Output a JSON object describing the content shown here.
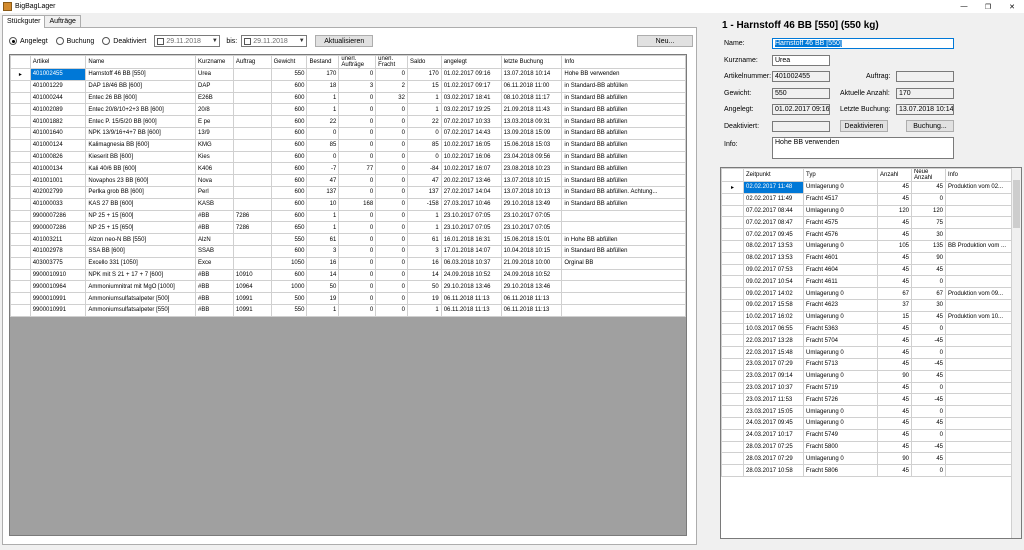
{
  "window": {
    "title": "BigBagLager",
    "controls": [
      "—",
      "❐",
      "✕"
    ]
  },
  "tabs": [
    "Stückguter",
    "Aufträge"
  ],
  "filter": {
    "radios": [
      {
        "label": "Angelegt",
        "checked": true
      },
      {
        "label": "Buchung",
        "checked": false
      },
      {
        "label": "Deaktiviert",
        "checked": false
      }
    ],
    "date_from": "29.11.2018",
    "bis_label": "bis:",
    "date_to": "29.11.2018",
    "refresh_label": "Aktualisieren",
    "new_label": "Neu..."
  },
  "grid": {
    "columns": [
      "Artikel",
      "Name",
      "Kurzname",
      "Auftrag",
      "Gewicht",
      "Bestand",
      "unerl. Aufträge",
      "unerl. Fracht",
      "Saldo",
      "angelegt",
      "letzte Buchung",
      "Info"
    ],
    "rows": [
      [
        "401002455",
        "Harnstoff 46 BB [550]",
        "Urea",
        "",
        "550",
        "170",
        "0",
        "0",
        "170",
        "01.02.2017 09:16",
        "13.07.2018 10:14",
        "Hohe BB verwenden"
      ],
      [
        "401001229",
        "DAP 18/46 BB [600]",
        "DAP",
        "",
        "600",
        "18",
        "3",
        "2",
        "15",
        "01.02.2017 09:17",
        "06.11.2018 11:00",
        "in Standard-BB abfüllen"
      ],
      [
        "401000244",
        "Entec 26 BB [600]",
        "E26B",
        "",
        "600",
        "1",
        "0",
        "32",
        "1",
        "03.02.2017 18:41",
        "08.10.2018 11:17",
        "in Standard BB abfüllen"
      ],
      [
        "401002089",
        "Entec 20/8/10+2+3 BB [600]",
        "20/8",
        "",
        "600",
        "1",
        "0",
        "0",
        "1",
        "03.02.2017 19:25",
        "21.09.2018 11:43",
        "in Standard BB abfüllen"
      ],
      [
        "401001882",
        "Entec P. 15/5/20 BB [600]",
        "E pe",
        "",
        "600",
        "22",
        "0",
        "0",
        "22",
        "07.02.2017 10:33",
        "13.03.2018 09:31",
        "in Standard BB abfüllen"
      ],
      [
        "401001640",
        "NPK 13/9/16+4+7 BB [600]",
        "13/9",
        "",
        "600",
        "0",
        "0",
        "0",
        "0",
        "07.02.2017 14:43",
        "13.09.2018 15:09",
        "in Standard BB abfüllen"
      ],
      [
        "401000124",
        "Kalimagnesia BB [600]",
        "KMG",
        "",
        "600",
        "85",
        "0",
        "0",
        "85",
        "10.02.2017 16:05",
        "15.06.2018 15:03",
        "in Standard BB abfüllen"
      ],
      [
        "401000826",
        "Kieserit BB [600]",
        "Kies",
        "",
        "600",
        "0",
        "0",
        "0",
        "0",
        "10.02.2017 16:06",
        "23.04.2018 09:56",
        "in Standard BB abfüllen"
      ],
      [
        "401000134",
        "Kali 40/6 BB [600]",
        "K406",
        "",
        "600",
        "-7",
        "77",
        "0",
        "-84",
        "10.02.2017 16:07",
        "23.08.2018 10:23",
        "in Standard BB abfüllen"
      ],
      [
        "401001001",
        "Novaphos 23 BB [600]",
        "Nova",
        "",
        "600",
        "47",
        "0",
        "0",
        "47",
        "20.02.2017 13:46",
        "13.07.2018 10:15",
        "in Standard BB abfüllen"
      ],
      [
        "402002799",
        "Perlka grob BB [600]",
        "Perl",
        "",
        "600",
        "137",
        "0",
        "0",
        "137",
        "27.02.2017 14:04",
        "13.07.2018 10:13",
        "in Standard BB abfüllen. Achtung..."
      ],
      [
        "401000033",
        "KAS 27 BB [600]",
        "KASB",
        "",
        "600",
        "10",
        "168",
        "0",
        "-158",
        "27.03.2017 10:46",
        "29.10.2018 13:49",
        "in Standard BB abfüllen"
      ],
      [
        "9900007286",
        "NP 25 + 15 [600]",
        "#BB",
        "7286",
        "600",
        "1",
        "0",
        "0",
        "1",
        "23.10.2017 07:05",
        "23.10.2017 07:05",
        ""
      ],
      [
        "9900007286",
        "NP 25 + 15 [650]",
        "#BB",
        "7286",
        "650",
        "1",
        "0",
        "0",
        "1",
        "23.10.2017 07:05",
        "23.10.2017 07:05",
        ""
      ],
      [
        "401003211",
        "Alzon neo-N BB [550]",
        "AlzN",
        "",
        "550",
        "61",
        "0",
        "0",
        "61",
        "16.01.2018 16:31",
        "15.06.2018 15:01",
        "in Hohe BB abfüllen"
      ],
      [
        "401002978",
        "SSA BB [600]",
        "SSAB",
        "",
        "600",
        "3",
        "0",
        "0",
        "3",
        "17.01.2018 14:07",
        "10.04.2018 10:15",
        "in Standard BB abfüllen"
      ],
      [
        "403003775",
        "Excello 331 [1050]",
        "Exce",
        "",
        "1050",
        "16",
        "0",
        "0",
        "16",
        "06.03.2018 10:37",
        "21.09.2018 10:00",
        "Orginal BB"
      ],
      [
        "9900010910",
        "NPK mit  S 21 + 17 +  7 [600]",
        "#BB",
        "10910",
        "600",
        "14",
        "0",
        "0",
        "14",
        "24.09.2018 10:52",
        "24.09.2018 10:52",
        ""
      ],
      [
        "9900010964",
        "Ammoniumnitrat mit  MgO [1000]",
        "#BB",
        "10964",
        "1000",
        "50",
        "0",
        "0",
        "50",
        "29.10.2018 13:46",
        "29.10.2018 13:46",
        ""
      ],
      [
        "9900010991",
        "Ammoniumsulfatsalpeter [500]",
        "#BB",
        "10991",
        "500",
        "19",
        "0",
        "0",
        "19",
        "06.11.2018 11:13",
        "06.11.2018 11:13",
        ""
      ],
      [
        "9900010991",
        "Ammoniumsulfatsalpeter [550]",
        "#BB",
        "10991",
        "550",
        "1",
        "0",
        "0",
        "1",
        "06.11.2018 11:13",
        "06.11.2018 11:13",
        ""
      ]
    ]
  },
  "detail": {
    "heading": "1 - Harnstoff 46 BB [550] (550 kg)",
    "name_label": "Name:",
    "name_value": "Harnstoff 46 BB [550]",
    "kurzname_label": "Kurzname:",
    "kurzname_value": "Urea",
    "artikelnummer_label": "Artikelnummer:",
    "artikelnummer_value": "401002455",
    "auftrag_label": "Auftrag:",
    "auftrag_value": "",
    "gewicht_label": "Gewicht:",
    "gewicht_value": "550",
    "aktuelle_anzahl_label": "Aktuelle Anzahl:",
    "aktuelle_anzahl_value": "170",
    "angelegt_label": "Angelegt:",
    "angelegt_value": "01.02.2017 09:16",
    "letzte_buchung_label": "Letzte Buchung:",
    "letzte_buchung_value": "13.07.2018 10:14",
    "deaktiviert_label": "Deaktiviert:",
    "deaktiviert_value": "",
    "deaktivieren_label": "Deaktivieren",
    "buchung_label": "Buchung...",
    "info_label": "Info:",
    "info_value": "Hohe BB verwenden"
  },
  "history": {
    "columns": [
      "Zeitpunkt",
      "Typ",
      "Anzahl",
      "Neue Anzahl",
      "Info"
    ],
    "rows": [
      [
        "02.02.2017 11:48",
        "Umlagerung 0",
        "45",
        "45",
        "Produktion vom 02..."
      ],
      [
        "02.02.2017 11:49",
        "Fracht 4517",
        "45",
        "0",
        ""
      ],
      [
        "07.02.2017 08:44",
        "Umlagerung 0",
        "120",
        "120",
        ""
      ],
      [
        "07.02.2017 08:47",
        "Fracht 4575",
        "45",
        "75",
        ""
      ],
      [
        "07.02.2017 09:45",
        "Fracht 4576",
        "45",
        "30",
        ""
      ],
      [
        "08.02.2017 13:53",
        "Umlagerung 0",
        "105",
        "135",
        "BB Produktion vom ..."
      ],
      [
        "08.02.2017 13:53",
        "Fracht 4601",
        "45",
        "90",
        ""
      ],
      [
        "09.02.2017 07:53",
        "Fracht 4604",
        "45",
        "45",
        ""
      ],
      [
        "09.02.2017 10:54",
        "Fracht 4611",
        "45",
        "0",
        ""
      ],
      [
        "09.02.2017 14:02",
        "Umlagerung 0",
        "67",
        "67",
        "Produktion vom 09..."
      ],
      [
        "09.02.2017 15:58",
        "Fracht 4623",
        "37",
        "30",
        ""
      ],
      [
        "10.02.2017 16:02",
        "Umlagerung 0",
        "15",
        "45",
        "Produktion vom 10..."
      ],
      [
        "10.03.2017 06:55",
        "Fracht 5363",
        "45",
        "0",
        ""
      ],
      [
        "22.03.2017 13:28",
        "Fracht 5704",
        "45",
        "-45",
        ""
      ],
      [
        "22.03.2017 15:48",
        "Umlagerung 0",
        "45",
        "0",
        ""
      ],
      [
        "23.03.2017 07:29",
        "Fracht 5713",
        "45",
        "-45",
        ""
      ],
      [
        "23.03.2017 09:14",
        "Umlagerung 0",
        "90",
        "45",
        ""
      ],
      [
        "23.03.2017 10:37",
        "Fracht 5719",
        "45",
        "0",
        ""
      ],
      [
        "23.03.2017 11:53",
        "Fracht 5726",
        "45",
        "-45",
        ""
      ],
      [
        "23.03.2017 15:05",
        "Umlagerung 0",
        "45",
        "0",
        ""
      ],
      [
        "24.03.2017 09:45",
        "Umlagerung 0",
        "45",
        "45",
        ""
      ],
      [
        "24.03.2017 10:17",
        "Fracht 5749",
        "45",
        "0",
        ""
      ],
      [
        "28.03.2017 07:25",
        "Fracht 5800",
        "45",
        "-45",
        ""
      ],
      [
        "28.03.2017 07:29",
        "Umlagerung 0",
        "90",
        "45",
        ""
      ],
      [
        "28.03.2017 10:58",
        "Fracht 5806",
        "45",
        "0",
        ""
      ]
    ]
  }
}
